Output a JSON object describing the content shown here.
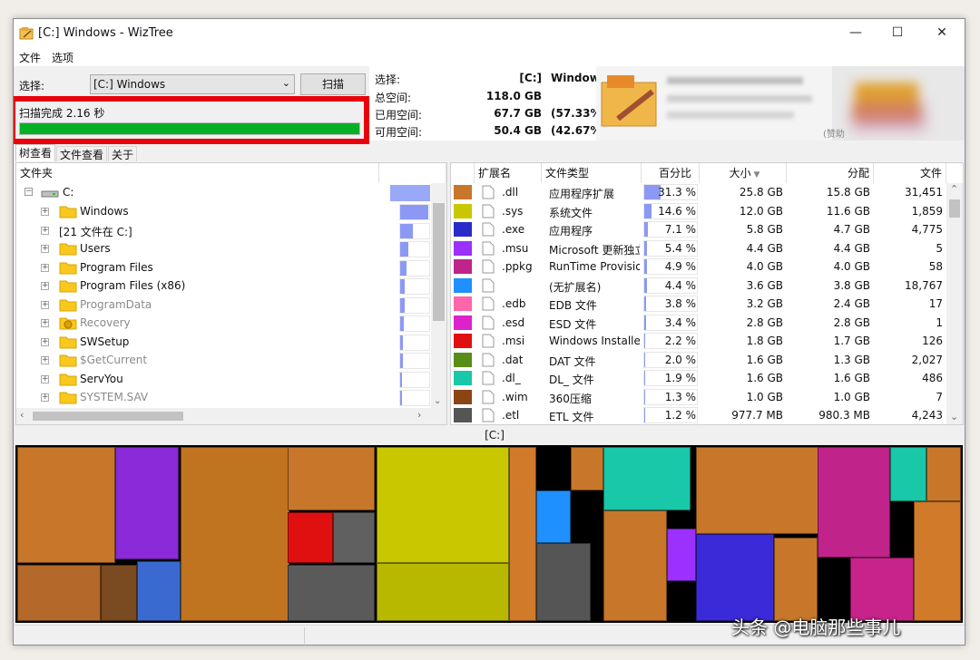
{
  "window": {
    "title": "[C:] Windows  - WizTree"
  },
  "menu": {
    "file": "文件",
    "options": "选项"
  },
  "toolbar": {
    "select_label": "选择:",
    "drive_value": "[C:] Windows",
    "scan_button": "扫描",
    "status_text": "扫描完成 2.16 秒",
    "progress": 1.0
  },
  "stats": {
    "select_label": "选择:",
    "select_value": "[C:]",
    "select_path": "Window",
    "total_label": "总空间:",
    "total_value": "118.0 GB",
    "used_label": "已用空间:",
    "used_value": "67.7 GB",
    "used_pct": "(57.33%",
    "free_label": "可用空间:",
    "free_value": "50.4 GB",
    "free_pct": "(42.67%"
  },
  "banner": {
    "caption": "(赞助"
  },
  "tabs": [
    "树查看",
    "文件查看",
    "关于"
  ],
  "tree": {
    "header": "文件夹",
    "root": "C:",
    "items": [
      {
        "label": "Windows",
        "icon": "folder",
        "dim": false,
        "bar": 0.9
      },
      {
        "label": "[21 文件在 C:]",
        "icon": "none",
        "dim": false,
        "bar": 0.4
      },
      {
        "label": "Users",
        "icon": "folder",
        "dim": false,
        "bar": 0.25
      },
      {
        "label": "Program Files",
        "icon": "folder",
        "dim": false,
        "bar": 0.2
      },
      {
        "label": "Program Files (x86)",
        "icon": "folder",
        "dim": false,
        "bar": 0.15
      },
      {
        "label": "ProgramData",
        "icon": "folder",
        "dim": true,
        "bar": 0.14
      },
      {
        "label": "Recovery",
        "icon": "gear-folder",
        "dim": true,
        "bar": 0.12
      },
      {
        "label": "SWSetup",
        "icon": "folder",
        "dim": false,
        "bar": 0.1
      },
      {
        "label": "$GetCurrent",
        "icon": "folder",
        "dim": true,
        "bar": 0.09
      },
      {
        "label": "ServYou",
        "icon": "folder",
        "dim": false,
        "bar": 0.05
      },
      {
        "label": "SYSTEM.SAV",
        "icon": "folder",
        "dim": true,
        "bar": 0.03
      }
    ]
  },
  "filetypes": {
    "headers": [
      "扩展名",
      "文件类型",
      "百分比",
      "大小",
      "分配",
      "文件"
    ],
    "rows": [
      {
        "color": "#c8772a",
        "ext": ".dll",
        "type": "应用程序扩展",
        "pct": "31.3 %",
        "pct_value": 31.3,
        "size": "25.8 GB",
        "alloc": "15.8 GB",
        "files": "31,451"
      },
      {
        "color": "#c9c800",
        "ext": ".sys",
        "type": "系统文件",
        "pct": "14.6 %",
        "pct_value": 14.6,
        "size": "12.0 GB",
        "alloc": "11.6 GB",
        "files": "1,859"
      },
      {
        "color": "#2a2acb",
        "ext": ".exe",
        "type": "应用程序",
        "pct": "7.1 %",
        "pct_value": 7.1,
        "size": "5.8 GB",
        "alloc": "4.7 GB",
        "files": "4,775"
      },
      {
        "color": "#9b30ff",
        "ext": ".msu",
        "type": "Microsoft 更新独立",
        "pct": "5.4 %",
        "pct_value": 5.4,
        "size": "4.4 GB",
        "alloc": "4.4 GB",
        "files": "5"
      },
      {
        "color": "#c0238a",
        "ext": ".ppkg",
        "type": "RunTime Provision",
        "pct": "4.9 %",
        "pct_value": 4.9,
        "size": "4.0 GB",
        "alloc": "4.0 GB",
        "files": "58"
      },
      {
        "color": "#1e90ff",
        "ext": "",
        "type": "(无扩展名)",
        "pct": "4.4 %",
        "pct_value": 4.4,
        "size": "3.6 GB",
        "alloc": "3.8 GB",
        "files": "18,767"
      },
      {
        "color": "#ff66aa",
        "ext": ".edb",
        "type": "EDB 文件",
        "pct": "3.8 %",
        "pct_value": 3.8,
        "size": "3.2 GB",
        "alloc": "2.4 GB",
        "files": "17"
      },
      {
        "color": "#dd22cc",
        "ext": ".esd",
        "type": "ESD 文件",
        "pct": "3.4 %",
        "pct_value": 3.4,
        "size": "2.8 GB",
        "alloc": "2.8 GB",
        "files": "1"
      },
      {
        "color": "#e01010",
        "ext": ".msi",
        "type": "Windows Installer",
        "pct": "2.2 %",
        "pct_value": 2.2,
        "size": "1.8 GB",
        "alloc": "1.7 GB",
        "files": "126"
      },
      {
        "color": "#5a8c18",
        "ext": ".dat",
        "type": "DAT 文件",
        "pct": "2.0 %",
        "pct_value": 2.0,
        "size": "1.6 GB",
        "alloc": "1.3 GB",
        "files": "2,027"
      },
      {
        "color": "#18c8a8",
        "ext": ".dl_",
        "type": "DL_ 文件",
        "pct": "1.9 %",
        "pct_value": 1.9,
        "size": "1.6 GB",
        "alloc": "1.6 GB",
        "files": "486"
      },
      {
        "color": "#8b4513",
        "ext": ".wim",
        "type": "360压缩",
        "pct": "1.3 %",
        "pct_value": 1.3,
        "size": "1.0 GB",
        "alloc": "1.0 GB",
        "files": "7"
      },
      {
        "color": "#555555",
        "ext": ".etl",
        "type": "ETL 文件",
        "pct": "1.2 %",
        "pct_value": 1.2,
        "size": "977.7 MB",
        "alloc": "980.3 MB",
        "files": "4,243"
      }
    ]
  },
  "treemap": {
    "label": "[C:]"
  },
  "watermark": "头条 @电脑那些事儿"
}
